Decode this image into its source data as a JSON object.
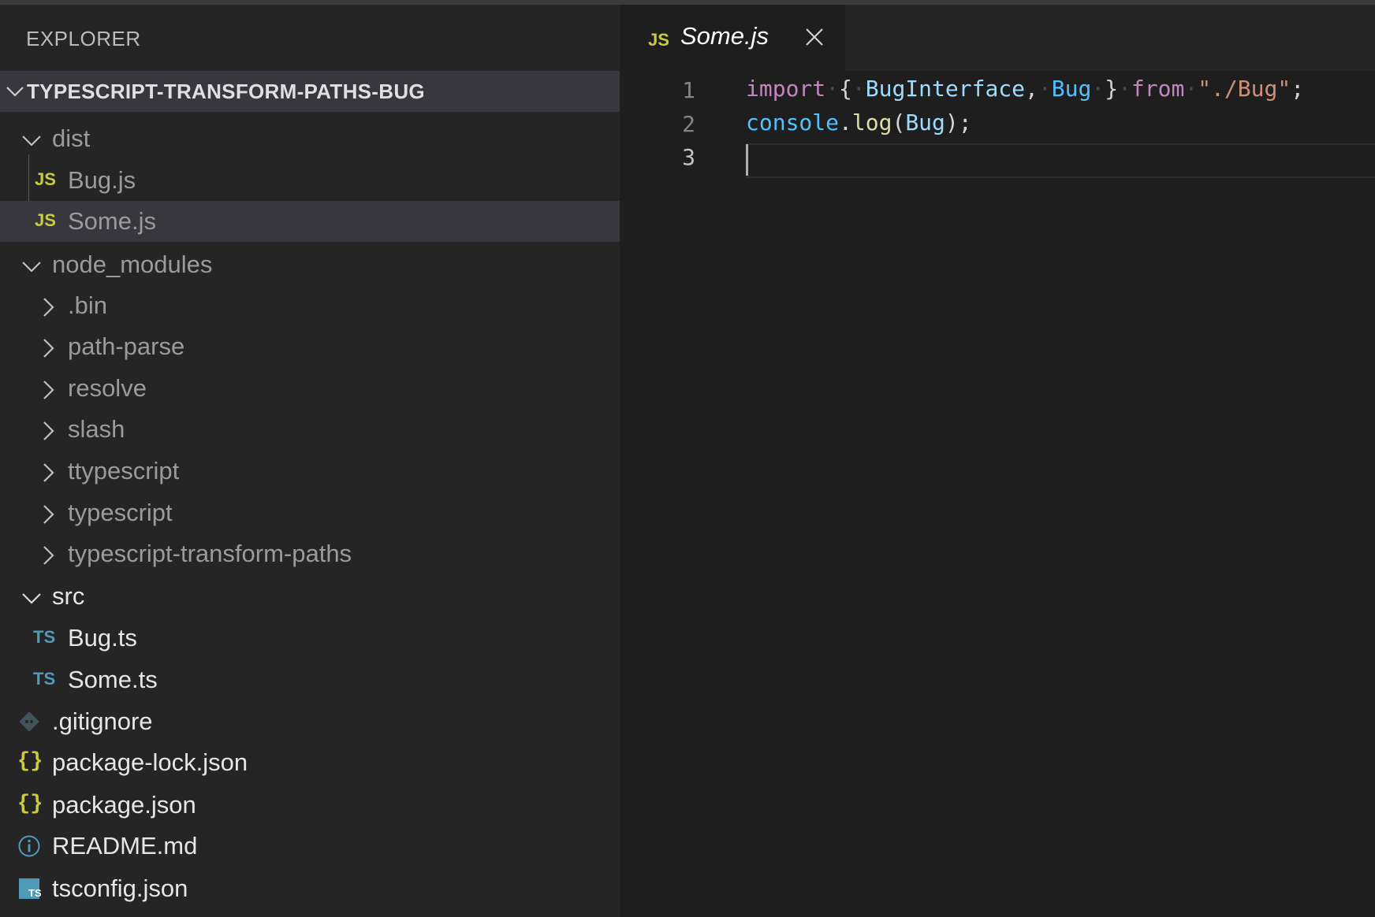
{
  "sidebar": {
    "title": "EXPLORER",
    "project": "TYPESCRIPT-TRANSFORM-PATHS-BUG",
    "tree": [
      {
        "label": "dist",
        "kind": "folder-open"
      },
      {
        "label": "Bug.js",
        "kind": "js"
      },
      {
        "label": "Some.js",
        "kind": "js",
        "selected": true
      },
      {
        "label": "node_modules",
        "kind": "folder-open"
      },
      {
        "label": ".bin",
        "kind": "folder-closed"
      },
      {
        "label": "path-parse",
        "kind": "folder-closed"
      },
      {
        "label": "resolve",
        "kind": "folder-closed"
      },
      {
        "label": "slash",
        "kind": "folder-closed"
      },
      {
        "label": "ttypescript",
        "kind": "folder-closed"
      },
      {
        "label": "typescript",
        "kind": "folder-closed"
      },
      {
        "label": "typescript-transform-paths",
        "kind": "folder-closed"
      },
      {
        "label": "src",
        "kind": "folder-open"
      },
      {
        "label": "Bug.ts",
        "kind": "ts"
      },
      {
        "label": "Some.ts",
        "kind": "ts"
      },
      {
        "label": ".gitignore",
        "kind": "git"
      },
      {
        "label": "package-lock.json",
        "kind": "json"
      },
      {
        "label": "package.json",
        "kind": "json"
      },
      {
        "label": "README.md",
        "kind": "info"
      },
      {
        "label": "tsconfig.json",
        "kind": "tsconfig"
      }
    ],
    "icons": {
      "js": "JS",
      "ts": "TS",
      "json": "{}",
      "tsconfig": "TS"
    }
  },
  "editor": {
    "tab": {
      "icon": "JS",
      "name": "Some.js",
      "close_icon": "close-icon"
    },
    "line_numbers": [
      "1",
      "2",
      "3"
    ],
    "lines": {
      "l1": {
        "import": "import",
        "ob": "{",
        "t1": "BugInterface",
        "comma": ",",
        "t2": "Bug",
        "cb": "}",
        "from": "from",
        "src": "\"./Bug\"",
        "semi": ";"
      },
      "l2": {
        "obj": "console",
        "dot": ".",
        "fn": "log",
        "op": "(",
        "arg": "Bug",
        "cp": ")",
        "semi": ";"
      }
    }
  },
  "colors": {
    "js_icon": "#cbcb41",
    "ts_icon": "#519aba",
    "keyword": "#c586c0",
    "string": "#ce9178",
    "identifier": "#9cdcfe"
  }
}
